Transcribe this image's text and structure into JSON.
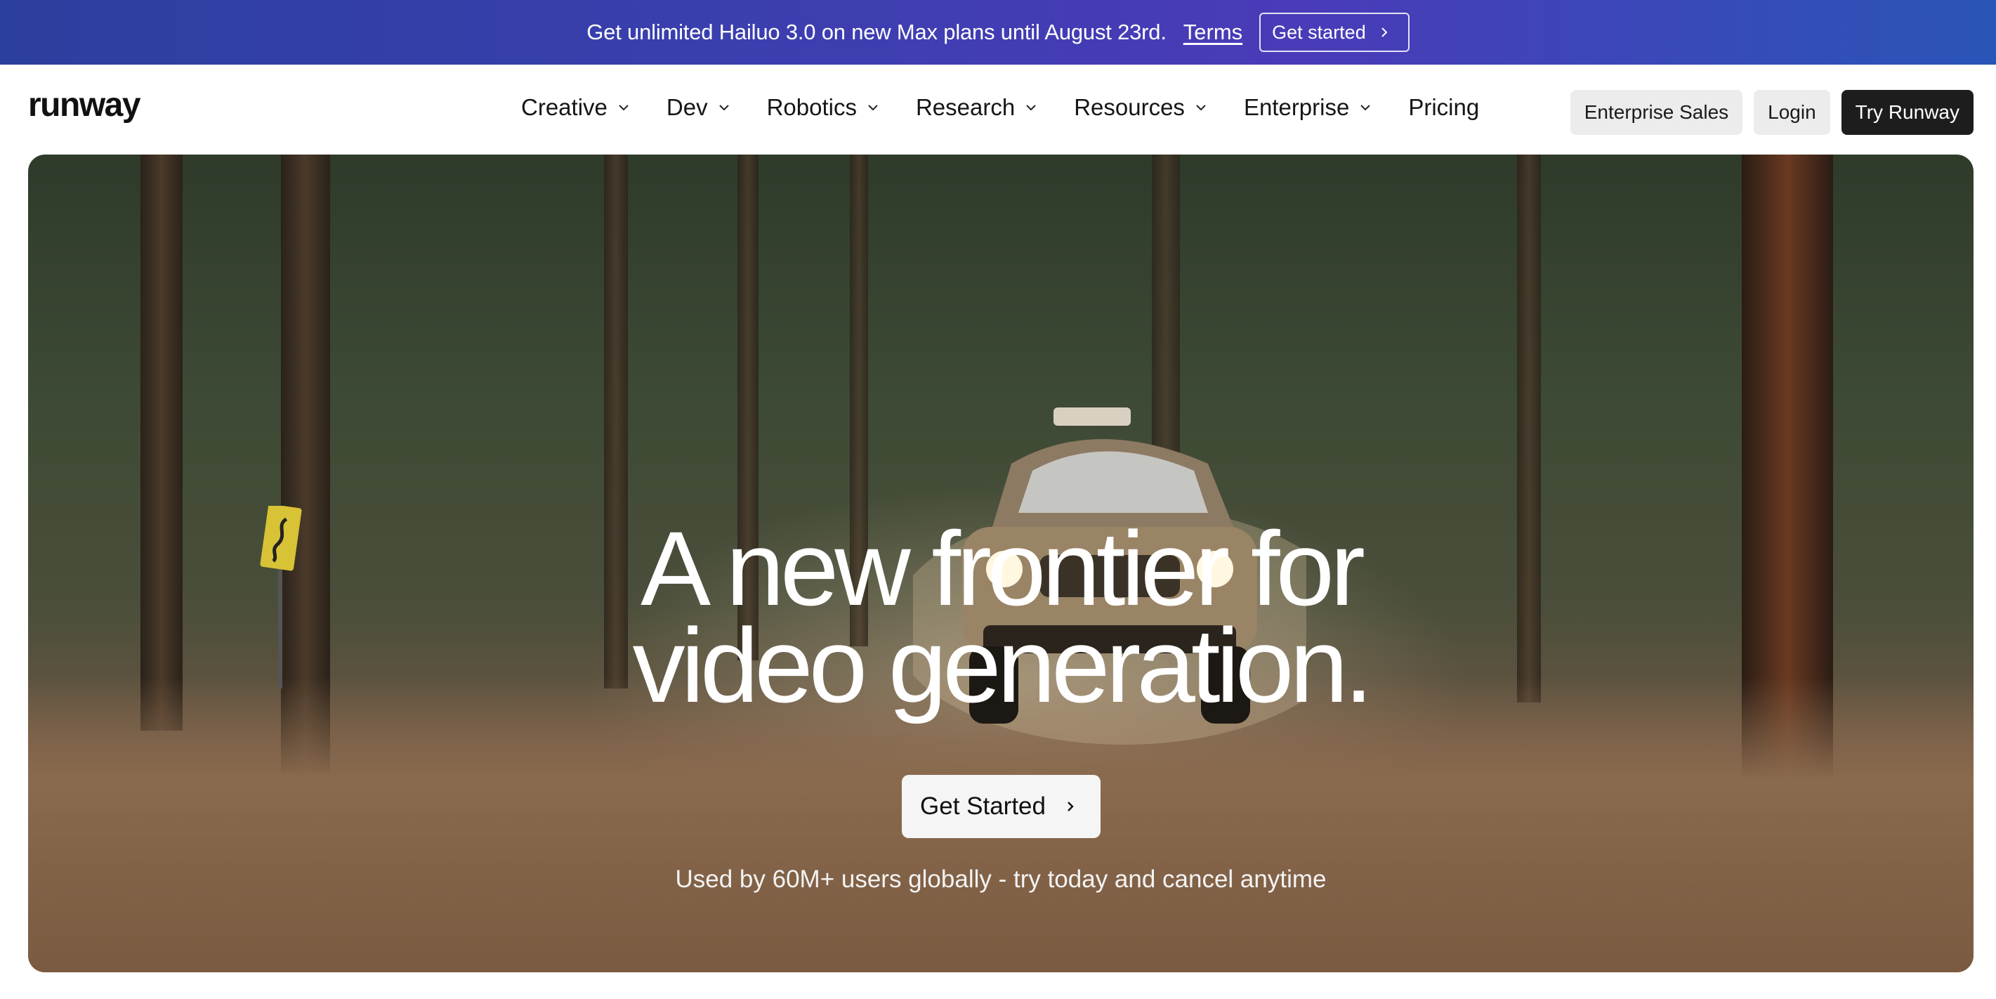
{
  "banner": {
    "text": "Get unlimited Hailuo 3.0 on new Max plans until August 23rd.",
    "terms_label": "Terms",
    "cta_label": "Get started"
  },
  "header": {
    "logo": "runway",
    "nav": [
      {
        "label": "Creative",
        "has_menu": true
      },
      {
        "label": "Dev",
        "has_menu": true
      },
      {
        "label": "Robotics",
        "has_menu": true
      },
      {
        "label": "Research",
        "has_menu": true
      },
      {
        "label": "Resources",
        "has_menu": true
      },
      {
        "label": "Enterprise",
        "has_menu": true
      },
      {
        "label": "Pricing",
        "has_menu": false
      }
    ],
    "actions": {
      "enterprise_sales": "Enterprise Sales",
      "login": "Login",
      "try": "Try Runway"
    }
  },
  "hero": {
    "title_line1": "A new frontier for",
    "title_line2": "video generation.",
    "cta_label": "Get Started",
    "subtitle": "Used by 60M+ users globally - try today and cancel anytime"
  },
  "colors": {
    "banner_start": "#2b3f9e",
    "banner_end": "#2a55b8",
    "dark_button": "#1d1d1d",
    "light_button": "#ececec"
  }
}
